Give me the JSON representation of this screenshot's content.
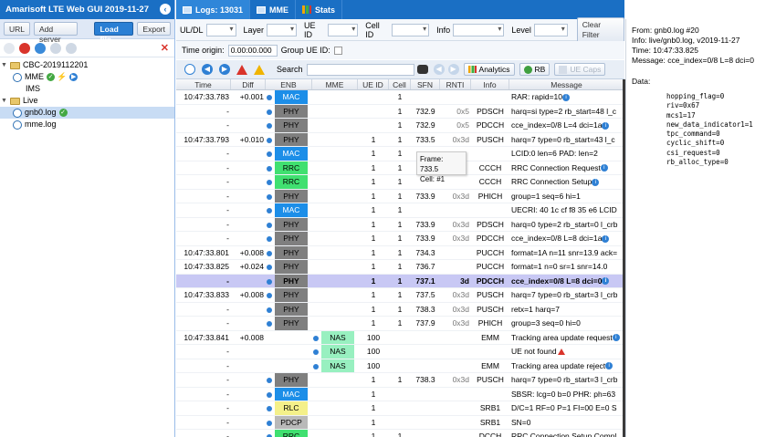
{
  "app": {
    "title": "Amarisoft LTE Web GUI 2019-11-27"
  },
  "left_buttons": {
    "url": "URL",
    "add_server": "Add server",
    "load_file": "Load file",
    "export": "Export"
  },
  "tree": {
    "server": "CBC-2019112201",
    "mme": "MME",
    "ims": "IMS",
    "live": "Live",
    "gnb_log": "gnb0.log",
    "mme_log": "mme.log"
  },
  "tabs": {
    "logs": "Logs: 13031",
    "mme": "MME",
    "stats": "Stats"
  },
  "filters": {
    "ul_dl": "UL/DL",
    "layer": "Layer",
    "ue_id": "UE ID",
    "cell_id": "Cell ID",
    "info": "Info",
    "level": "Level",
    "clear": "Clear Filter",
    "time_origin_label": "Time origin:",
    "time_origin_value": "0.00:00.000",
    "group_ue_id": "Group UE ID:"
  },
  "toolbar": {
    "search_label": "Search",
    "analytics": "Analytics",
    "rb": "RB",
    "ue_caps": "UE Caps"
  },
  "columns": [
    "Time",
    "Diff",
    "ENB",
    "MME",
    "UE ID",
    "Cell",
    "SFN",
    "RNTI",
    "Info",
    "Message"
  ],
  "layer_colors": {
    "MAC": "#1c8ee8",
    "PHY": "#7f7f7f",
    "RRC": "#40e070",
    "NAS": "#98f0c0",
    "RLC": "#f4f08a",
    "PDCP": "#b9b9b9"
  },
  "rows": [
    {
      "time": "10:47:33.783",
      "diff": "+0.001",
      "enb": "MAC",
      "mme": "",
      "ue": "",
      "cell": "1",
      "sfn": "",
      "rnti": "",
      "info": "",
      "msg": "RAR: rapid=10",
      "icon": "info"
    },
    {
      "time": "-",
      "diff": "",
      "enb": "PHY",
      "mme": "",
      "ue": "",
      "cell": "1",
      "sfn": "732.9",
      "rnti": "0x5",
      "info": "PDSCH",
      "msg": "harq=si type=2 rb_start=48 l_c"
    },
    {
      "time": "-",
      "diff": "",
      "enb": "PHY",
      "mme": "",
      "ue": "",
      "cell": "1",
      "sfn": "732.9",
      "rnti": "0x5",
      "info": "PDCCH",
      "msg": "cce_index=0/8 L=4 dci=1a",
      "icon": "info"
    },
    {
      "time": "10:47:33.793",
      "diff": "+0.010",
      "enb": "PHY",
      "mme": "",
      "ue": "1",
      "cell": "1",
      "sfn": "733.5",
      "rnti": "0x3d",
      "info": "PUSCH",
      "msg": "harq=7 type=0 rb_start=43 l_c"
    },
    {
      "time": "-",
      "diff": "",
      "enb": "MAC",
      "mme": "",
      "ue": "1",
      "cell": "1",
      "sfn": "",
      "rnti": "",
      "info": "",
      "msg": "LCID:0 len=6 PAD: len=2"
    },
    {
      "time": "-",
      "diff": "",
      "enb": "RRC",
      "mme": "",
      "ue": "1",
      "cell": "1",
      "sfn": "",
      "rnti": "",
      "info": "CCCH",
      "msg": "RRC Connection Request",
      "icon": "info"
    },
    {
      "time": "-",
      "diff": "",
      "enb": "RRC",
      "mme": "",
      "ue": "1",
      "cell": "1",
      "sfn": "",
      "rnti": "",
      "info": "CCCH",
      "msg": "RRC Connection Setup",
      "icon": "info"
    },
    {
      "time": "-",
      "diff": "",
      "enb": "PHY",
      "mme": "",
      "ue": "1",
      "cell": "1",
      "sfn": "733.9",
      "rnti": "0x3d",
      "info": "PHICH",
      "msg": "group=1 seq=6 hi=1"
    },
    {
      "time": "-",
      "diff": "",
      "enb": "MAC",
      "mme": "",
      "ue": "1",
      "cell": "1",
      "sfn": "",
      "rnti": "",
      "info": "",
      "msg": "UECRI: 40 1c cf f8 35 e6 LCID"
    },
    {
      "time": "-",
      "diff": "",
      "enb": "PHY",
      "mme": "",
      "ue": "1",
      "cell": "1",
      "sfn": "733.9",
      "rnti": "0x3d",
      "info": "PDSCH",
      "msg": "harq=0 type=2 rb_start=0 l_crb"
    },
    {
      "time": "-",
      "diff": "",
      "enb": "PHY",
      "mme": "",
      "ue": "1",
      "cell": "1",
      "sfn": "733.9",
      "rnti": "0x3d",
      "info": "PDCCH",
      "msg": "cce_index=0/8 L=8 dci=1a",
      "icon": "info"
    },
    {
      "time": "10:47:33.801",
      "diff": "+0.008",
      "enb": "PHY",
      "mme": "",
      "ue": "1",
      "cell": "1",
      "sfn": "734.3",
      "rnti": "",
      "info": "PUCCH",
      "msg": "format=1A n=11 snr=13.9 ack="
    },
    {
      "time": "10:47:33.825",
      "diff": "+0.024",
      "enb": "PHY",
      "mme": "",
      "ue": "1",
      "cell": "1",
      "sfn": "736.7",
      "rnti": "",
      "info": "PUCCH",
      "msg": "format=1 n=0 sr=1 snr=14.0"
    },
    {
      "time": "-",
      "diff": "",
      "enb": "PHY",
      "mme": "",
      "ue": "1",
      "cell": "1",
      "sfn": "737.1",
      "rnti": "3d",
      "info": "PDCCH",
      "msg": "cce_index=0/8 L=8 dci=0",
      "icon": "info",
      "hl": true
    },
    {
      "time": "10:47:33.833",
      "diff": "+0.008",
      "enb": "PHY",
      "mme": "",
      "ue": "1",
      "cell": "1",
      "sfn": "737.5",
      "rnti": "0x3d",
      "info": "PUSCH",
      "msg": "harq=7 type=0 rb_start=3 l_crb"
    },
    {
      "time": "-",
      "diff": "",
      "enb": "PHY",
      "mme": "",
      "ue": "1",
      "cell": "1",
      "sfn": "738.3",
      "rnti": "0x3d",
      "info": "PUSCH",
      "msg": "retx=1 harq=7"
    },
    {
      "time": "-",
      "diff": "",
      "enb": "PHY",
      "mme": "",
      "ue": "1",
      "cell": "1",
      "sfn": "737.9",
      "rnti": "0x3d",
      "info": "PHICH",
      "msg": "group=3 seq=0 hi=0"
    },
    {
      "time": "10:47:33.841",
      "diff": "+0.008",
      "enb": "",
      "mme": "NAS",
      "ue": "100",
      "cell": "",
      "sfn": "",
      "rnti": "",
      "info": "EMM",
      "msg": "Tracking area update request",
      "icon": "info"
    },
    {
      "time": "-",
      "diff": "",
      "enb": "",
      "mme": "NAS",
      "ue": "100",
      "cell": "",
      "sfn": "",
      "rnti": "",
      "info": "",
      "msg": "UE not found",
      "icon": "warn"
    },
    {
      "time": "-",
      "diff": "",
      "enb": "",
      "mme": "NAS",
      "ue": "100",
      "cell": "",
      "sfn": "",
      "rnti": "",
      "info": "EMM",
      "msg": "Tracking area update reject",
      "icon": "info"
    },
    {
      "time": "-",
      "diff": "",
      "enb": "PHY",
      "mme": "",
      "ue": "1",
      "cell": "1",
      "sfn": "738.3",
      "rnti": "0x3d",
      "info": "PUSCH",
      "msg": "harq=7 type=0 rb_start=3 l_crb"
    },
    {
      "time": "-",
      "diff": "",
      "enb": "MAC",
      "mme": "",
      "ue": "1",
      "cell": "",
      "sfn": "",
      "rnti": "",
      "info": "",
      "msg": "SBSR: lcg=0 b=0 PHR: ph=63"
    },
    {
      "time": "-",
      "diff": "",
      "enb": "RLC",
      "mme": "",
      "ue": "1",
      "cell": "",
      "sfn": "",
      "rnti": "",
      "info": "SRB1",
      "msg": "D/C=1 RF=0 P=1 FI=00 E=0 S"
    },
    {
      "time": "-",
      "diff": "",
      "enb": "PDCP",
      "mme": "",
      "ue": "1",
      "cell": "",
      "sfn": "",
      "rnti": "",
      "info": "SRB1",
      "msg": "SN=0"
    },
    {
      "time": "-",
      "diff": "",
      "enb": "RRC",
      "mme": "",
      "ue": "1",
      "cell": "1",
      "sfn": "",
      "rnti": "",
      "info": "DCCH",
      "msg": "RRC Connection Setup Compl"
    }
  ],
  "tooltip": {
    "frame": "Frame: 733.5",
    "cell": "Cell: #1"
  },
  "details": {
    "from": "From: gnb0.log #20",
    "info": "Info: live/gnb0.log, v2019-11-27",
    "time": "Time: 10:47:33.825",
    "message": "Message: cce_index=0/8 L=8 dci=0",
    "data_label": "Data:",
    "data": "hopping_flag=0\nriv=0x67\nmcs1=17\nnew_data_indicator1=1\ntpc_command=0\ncyclic_shift=0\ncsi_request=0\nrb_alloc_type=0"
  }
}
